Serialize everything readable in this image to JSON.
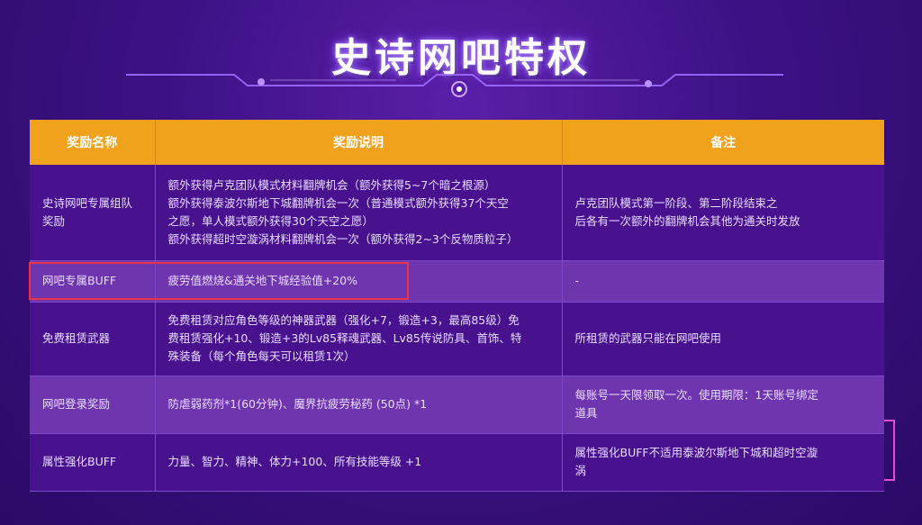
{
  "title": "史诗网吧特权",
  "colors": {
    "header": "#f0a21c",
    "row_dark": "#48128f",
    "row_light": "#6f35ae",
    "highlight": "#e8334a",
    "bracket": "#e14bd6"
  },
  "table": {
    "headers": [
      "奖励名称",
      "奖励说明",
      "备注"
    ],
    "rows": [
      {
        "name": "史诗网吧专属组队奖励",
        "desc": [
          "额外获得卢克团队模式材料翻牌机会（额外获得5~7个暗之根源）",
          "额外获得泰波尔斯地下城翻牌机会一次（普通模式额外获得37个天空",
          "之愿，单人模式额外获得30个天空之愿）",
          "额外获得超时空漩涡材料翻牌机会一次（额外获得2~3个反物质粒子）"
        ],
        "note": [
          "卢克团队模式第一阶段、第二阶段结束之",
          "后各有一次额外的翻牌机会其他为通关时发放"
        ]
      },
      {
        "name": "网吧专属BUFF",
        "desc": [
          "疲劳值燃烧&通关地下城经验值+20%"
        ],
        "note": [
          "-"
        ]
      },
      {
        "name": "免费租赁武器",
        "desc": [
          "免费租赁对应角色等级的神器武器（强化+7，锻造+3，最高85级）免",
          "费租赁强化+10、锻造+3的Lv85释魂武器、Lv85传说防具、首饰、特",
          "殊装备（每个角色每天可以租赁1次）"
        ],
        "note": [
          "所租赁的武器只能在网吧使用"
        ]
      },
      {
        "name": "网吧登录奖励",
        "desc": [
          "防虐弱药剂*1(60分钟)、魔界抗疲劳秘药 (50点) *1"
        ],
        "note": [
          "每账号一天限领取一次。使用期限：1天账号绑定",
          "道具"
        ]
      },
      {
        "name": "属性强化BUFF",
        "desc": [
          "力量、智力、精神、体力+100、所有技能等级 +1"
        ],
        "note": [
          "属性强化BUFF不适用泰波尔斯地下城和超时空漩",
          "涡"
        ]
      }
    ]
  }
}
